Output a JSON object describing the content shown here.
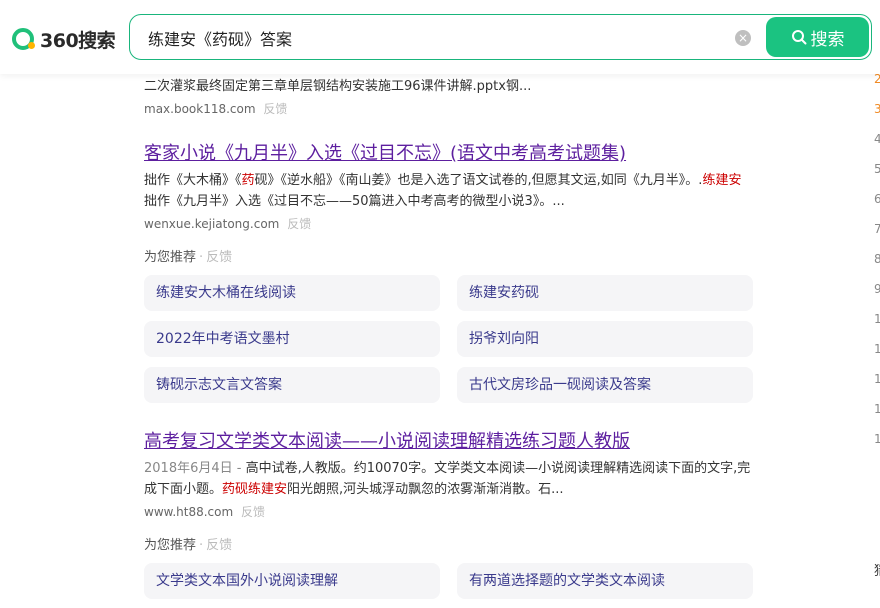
{
  "header": {
    "logo_text": "360搜索",
    "search_value": "练建安《药砚》答案",
    "clear_glyph": "×",
    "search_button": "搜索"
  },
  "results": {
    "r1": {
      "snippet": "二次灌浆最终固定第三章单层钢结构安装施工96课件讲解.pptx钢...",
      "url": "max.book118.com",
      "feedback": "反馈"
    },
    "r2": {
      "title": "客家小说《九月半》入选《过目不忘》(语文中考高考试题集)",
      "snippet_a": "拙作《大木桶》《",
      "snippet_hl1": "药",
      "snippet_b": "砚》《逆水船》《南山姜》也是入选了语文试卷的,但愿其文运,如同《九月半》。.",
      "snippet_hl2": "练建安",
      "snippet_c": "拙作《九月半》入选《过目不忘——50篇进入中考高考的微型小说3》。...",
      "url": "wenxue.kejiatong.com",
      "feedback": "反馈"
    },
    "rec1": {
      "label": "为您推荐",
      "feedback": "反馈",
      "items": [
        "练建安大木桶在线阅读",
        "练建安药砚",
        "2022年中考语文墨村",
        "拐爷刘向阳",
        "铸砚示志文言文答案",
        "古代文房珍品一砚阅读及答案"
      ]
    },
    "r3": {
      "title": "高考复习文学类文本阅读——小说阅读理解精选练习题人教版",
      "date": "2018年6月4日 -",
      "snippet_a": " 高中试卷,人教版。约10070字。文学类文本阅读—小说阅读理解精选阅读下面的文字,完成下面小题。",
      "snippet_hl": "药砚练建安",
      "snippet_b": "阳光朗照,河头城浮动飘忽的浓雾渐渐消散。石...",
      "url": "www.ht88.com",
      "feedback": "反馈"
    },
    "rec2": {
      "label": "为您推荐",
      "feedback": "反馈",
      "items": [
        "文学类文本国外小说阅读理解",
        "有两道选择题的文学类文本阅读"
      ]
    }
  },
  "right_col": {
    "numbers": [
      "2",
      "3",
      "4",
      "5",
      "6",
      "7",
      "8",
      "9",
      "1",
      "1",
      "1",
      "1",
      "1"
    ],
    "bottom_char": "猜"
  },
  "colors": {
    "accent": "#1bc381",
    "highlight": "#cc0000",
    "title": "#5d1f9f",
    "link": "#3a3a8c"
  }
}
